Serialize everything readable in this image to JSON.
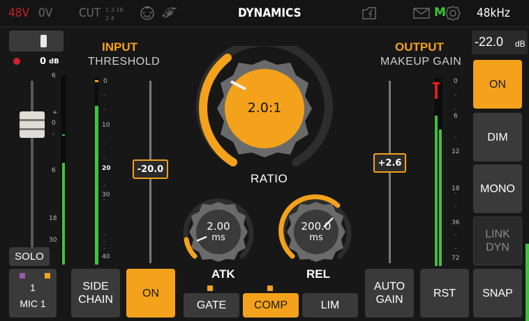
{
  "topbar": {
    "phantom": "48V",
    "phase": "0V",
    "cut": "CUT",
    "cut_freqs_top": "1  3  18",
    "cut_freqs_bottom": "2  4",
    "title": "DYNAMICS",
    "mute_letter": "M",
    "sample_rate": "48kHz"
  },
  "left_strip": {
    "level_value": "0",
    "level_unit": "dB",
    "fader_scale": [
      "6",
      "+",
      "0",
      "-",
      "6",
      "18",
      "30"
    ],
    "solo_label": "SOLO",
    "channel_number": "1",
    "channel_name": "MIC 1"
  },
  "input": {
    "title": "INPUT",
    "subtitle": "THRESHOLD",
    "meter_scale": [
      "0",
      "10",
      "20",
      "30",
      "40"
    ],
    "threshold_value": "-20.0",
    "threshold_level": 0.6
  },
  "ratio": {
    "value": "2.0:1",
    "label": "RATIO"
  },
  "attack": {
    "value": "2.00",
    "unit": "ms",
    "label": "ATK"
  },
  "release": {
    "value": "200.0",
    "unit": "ms",
    "label": "REL"
  },
  "output": {
    "title": "OUTPUT",
    "subtitle": "MAKEUP GAIN",
    "makeup_value": "+2.6",
    "meter_scale": [
      "0",
      "6",
      "12",
      "18",
      "36",
      "72"
    ]
  },
  "right_panel": {
    "output_level": "-22.0",
    "output_unit": "dB",
    "on_label": "ON",
    "dim_label": "DIM",
    "mono_label": "MONO",
    "link_dyn_line1": "LINK",
    "link_dyn_line2": "DYN",
    "snap_label": "SNAP"
  },
  "bottom": {
    "side_chain_line1": "SIDE",
    "side_chain_line2": "CHAIN",
    "on_label": "ON",
    "gate_label": "GATE",
    "comp_label": "COMP",
    "lim_label": "LIM",
    "auto_gain_line1": "AUTO",
    "auto_gain_line2": "GAIN",
    "rst_label": "RST"
  },
  "colors": {
    "accent": "#f4a21c",
    "phantom_red": "#c8202a",
    "meter_green": "#3ec43a",
    "clip_red": "#e0201a"
  }
}
